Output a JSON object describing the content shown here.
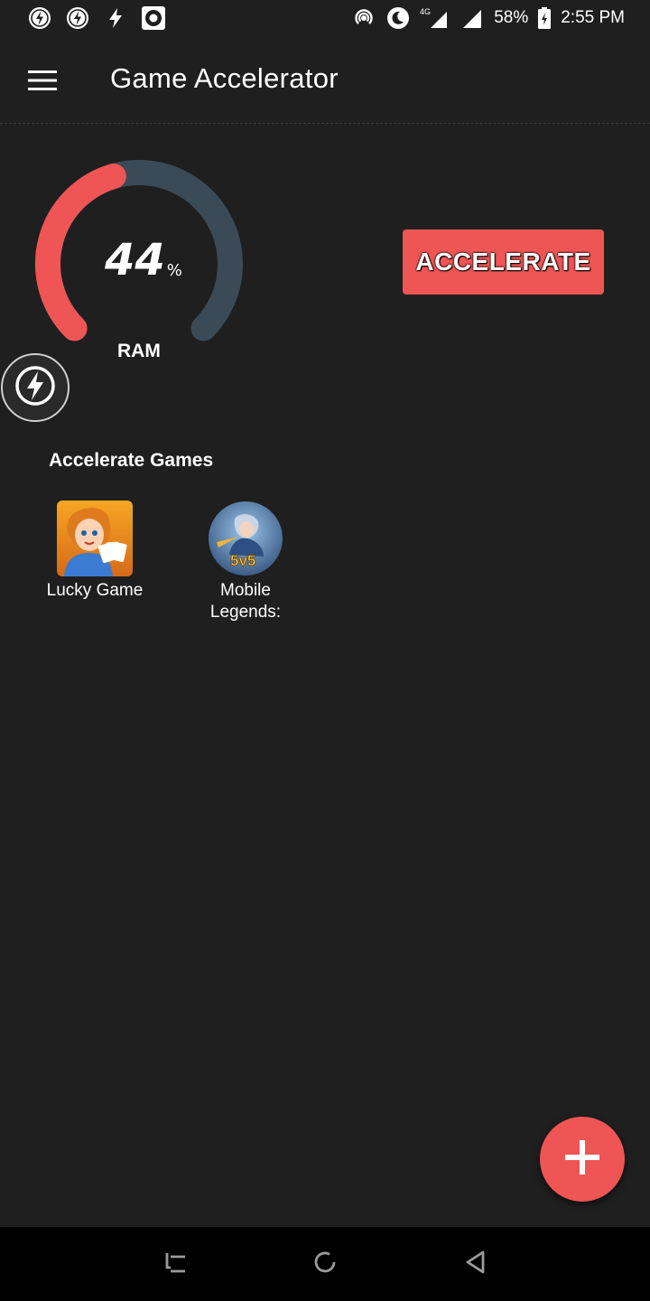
{
  "status_bar": {
    "battery": "58%",
    "time": "2:55 PM",
    "network": "4G",
    "left_icons": [
      "boost-notification-icon",
      "boost-notification-icon",
      "flash-icon",
      "record-icon"
    ],
    "right_icons": [
      "hotspot-icon",
      "do-not-disturb-icon",
      "signal-4g-icon",
      "signal-icon",
      "battery-icon"
    ]
  },
  "app_bar": {
    "title": "Game Accelerator",
    "menu_icon": "hamburger-menu-icon"
  },
  "gauge": {
    "value": "44",
    "unit": "%",
    "label": "RAM",
    "fraction": 0.44,
    "colors": {
      "used": "#ef5555",
      "track": "#3a4a57"
    }
  },
  "boost_badge": {
    "icon": "lightning-bolt-icon"
  },
  "accelerate_button": {
    "label": "ACCELERATE",
    "color": "#ef5555"
  },
  "games_section": {
    "title": "Accelerate Games",
    "games": [
      {
        "name": "Lucky Game",
        "icon": "lucky-game-app-icon"
      },
      {
        "name": "Mobile\nLegends:",
        "icon": "mobile-legends-app-icon"
      }
    ]
  },
  "fab": {
    "icon": "plus-icon",
    "color": "#ef5555"
  },
  "nav_bar": {
    "icons": [
      "recent-apps-icon",
      "home-icon",
      "back-icon"
    ]
  }
}
